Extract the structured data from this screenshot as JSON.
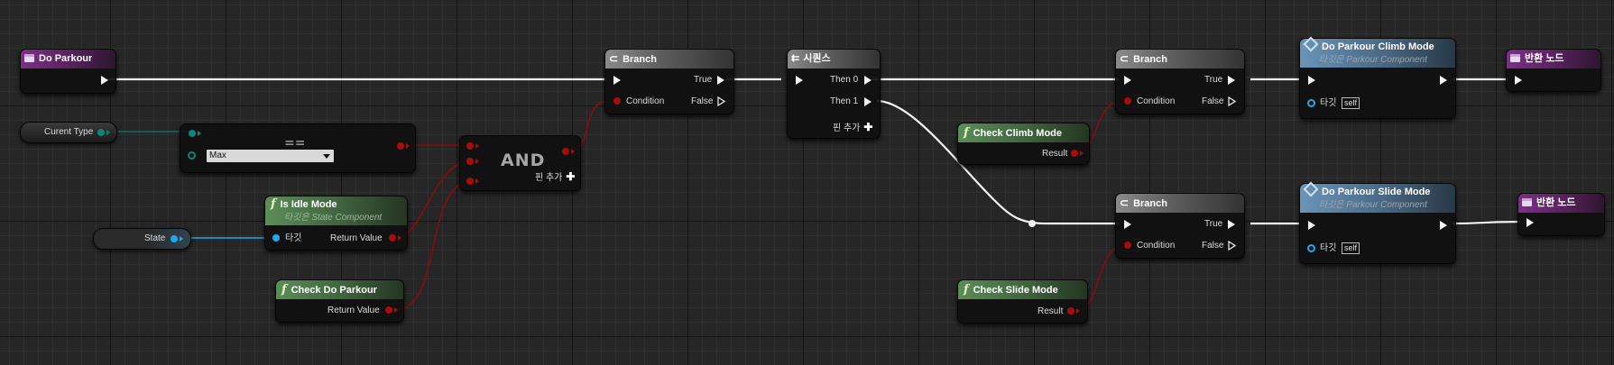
{
  "nodes": {
    "do_parkour": {
      "title": "Do Parkour"
    },
    "current_type": {
      "label": "Curent Type"
    },
    "equal": {
      "title": "==",
      "dropdown_value": "Max"
    },
    "and": {
      "title": "AND",
      "add_pin": "핀 추가"
    },
    "is_idle": {
      "title": "Is Idle Mode",
      "subtitle": "타깃은 State Component",
      "target": "타깃",
      "output": "Return Value"
    },
    "state": {
      "label": "State"
    },
    "check_do_parkour": {
      "title": "Check Do Parkour",
      "output": "Return Value"
    },
    "branch1": {
      "title": "Branch",
      "condition": "Condition",
      "true_label": "True",
      "false_label": "False"
    },
    "sequence": {
      "title": "시퀀스",
      "then0": "Then 0",
      "then1": "Then 1",
      "add_pin": "핀 추가"
    },
    "branch2": {
      "title": "Branch",
      "condition": "Condition",
      "true_label": "True",
      "false_label": "False"
    },
    "check_climb": {
      "title": "Check Climb Mode",
      "output": "Result"
    },
    "branch3": {
      "title": "Branch",
      "condition": "Condition",
      "true_label": "True",
      "false_label": "False"
    },
    "check_slide": {
      "title": "Check Slide Mode",
      "output": "Result"
    },
    "climb_mode": {
      "title": "Do Parkour Climb Mode",
      "subtitle": "타깃은 Parkour Component",
      "target": "타깃",
      "self": "self"
    },
    "slide_mode": {
      "title": "Do Parkour Slide Mode",
      "subtitle": "타깃은 Parkour Component",
      "target": "타깃",
      "self": "self"
    },
    "return1": {
      "title": "반환 노드"
    },
    "return2": {
      "title": "반환 노드"
    }
  },
  "colors": {
    "exec_wire": "#f2f2f2",
    "bool_wire": "#8a0d0d",
    "enum_wire": "#0d6e63",
    "object_wire": "#1ea8ee"
  }
}
